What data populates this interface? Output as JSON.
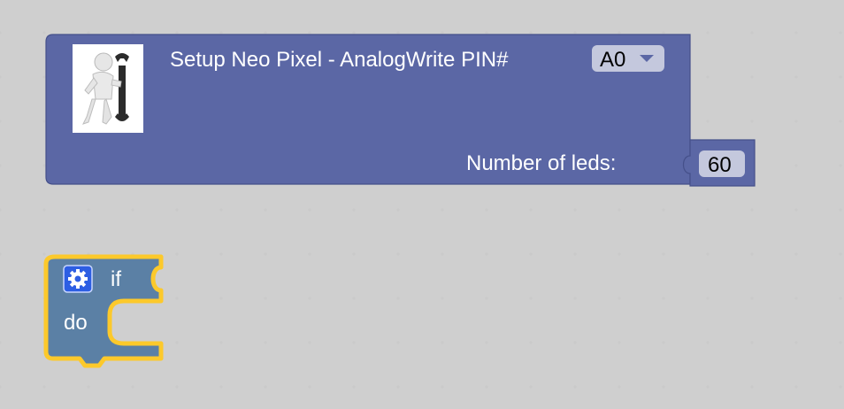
{
  "setup_block": {
    "title": "Setup Neo Pixel - AnalogWrite PIN#",
    "pin_value": "A0",
    "leds_label": "Number of leds:",
    "leds_value": "60",
    "image_icon": "man-with-wrench-icon"
  },
  "if_block": {
    "if_label": "if",
    "do_label": "do",
    "mutator_icon": "gear-icon"
  },
  "colors": {
    "setup_block_fill": "#5b67a5",
    "setup_block_stroke": "#45508a",
    "if_block_fill": "#5b80a5",
    "selection_highlight": "#fcc92b",
    "field_bg": "#c4c8dd"
  }
}
